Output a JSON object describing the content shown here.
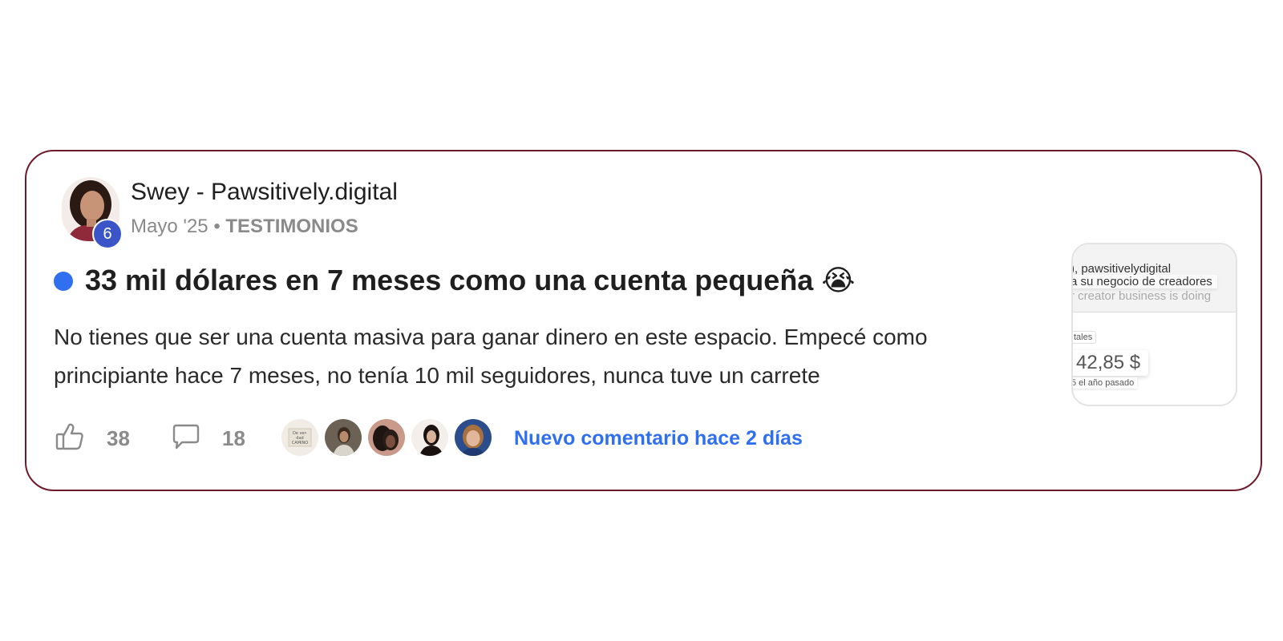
{
  "post": {
    "author": "Swey - Pawsitively.digital",
    "level": "6",
    "date": "Mayo '25",
    "separator": "•",
    "category": "TESTIMONIOS",
    "title": "33 mil dólares en 7 meses como una cuenta pequeña 😭",
    "body": "No tienes que ser una cuenta masiva para ganar dinero en este espacio. Empecé como principiante hace 7 meses, no tenía 10 mil seguidores, nunca tuve un carrete",
    "likes": "38",
    "comments": "18",
    "new_comment": "Nuevo comentario hace 2 días"
  },
  "thumbnail": {
    "line1": "), pawsitivelydigital",
    "line2": "a su negocio de creadores",
    "line3": "r creator business is doing",
    "chip": "tales",
    "value": "42,85 $",
    "sub": "5 el año pasado"
  },
  "commenter_avatars": [
    {
      "name": "commenter-avatar-1",
      "caption": "De ver-\ndad\nCAMINO"
    },
    {
      "name": "commenter-avatar-2"
    },
    {
      "name": "commenter-avatar-3"
    },
    {
      "name": "commenter-avatar-4"
    },
    {
      "name": "commenter-avatar-5"
    }
  ],
  "colors": {
    "card_border": "#6e1a2b",
    "accent_blue": "#2f6ff0",
    "level_badge": "#3b55c9",
    "muted": "#8a8a8a"
  },
  "icons": {
    "like": "thumbs-up-icon",
    "comment": "speech-bubble-icon",
    "unread": "unread-dot"
  }
}
